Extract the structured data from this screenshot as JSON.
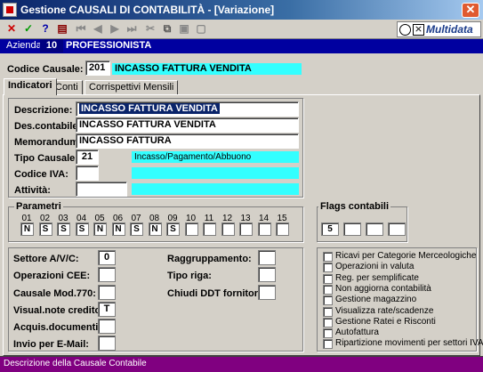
{
  "window": {
    "title": "Gestione CAUSALI DI CONTABILITÀ - [Variazione]",
    "close": "✕"
  },
  "toolbar": {
    "logo_text": "Multidata",
    "logo_x": "⨯"
  },
  "azienda": {
    "label": "Azienda:",
    "code": "10",
    "name": "PROFESSIONISTA"
  },
  "causale": {
    "label": "Codice Causale:",
    "code": "201",
    "description": "INCASSO FATTURA VENDITA"
  },
  "tabs": [
    {
      "label": "Indicatori"
    },
    {
      "label": "Conti"
    },
    {
      "label": "Corrispettivi Mensili"
    }
  ],
  "indicatori": {
    "descrizione": {
      "label": "Descrizione:",
      "value": "INCASSO FATTURA VENDITA"
    },
    "des_contabile": {
      "label": "Des.contabile:",
      "value": "INCASSO FATTURA VENDITA"
    },
    "memorandum": {
      "label": "Memorandum:",
      "value": "INCASSO FATTURA"
    },
    "tipo_causale": {
      "label": "Tipo Causale:",
      "value": "21",
      "description": "Incasso/Pagamento/Abbuono"
    },
    "codice_iva": {
      "label": "Codice IVA:",
      "value": ""
    },
    "attivita": {
      "label": "Attività:",
      "value": ""
    }
  },
  "parametri": {
    "title": "Parametri",
    "numbers": [
      "01",
      "02",
      "03",
      "04",
      "05",
      "06",
      "07",
      "08",
      "09",
      "10",
      "11",
      "12",
      "13",
      "14",
      "15"
    ],
    "values": [
      "N",
      "S",
      "S",
      "S",
      "N",
      "N",
      "S",
      "N",
      "S",
      "",
      "",
      "",
      "",
      "",
      ""
    ]
  },
  "flags": {
    "title": "Flags contabili",
    "values": [
      "5",
      "",
      "",
      ""
    ]
  },
  "settori": {
    "settore_avc": {
      "label": "Settore A/V/C:",
      "value": "0"
    },
    "operazioni_cee": {
      "label": "Operazioni CEE:",
      "value": ""
    },
    "causale_770": {
      "label": "Causale Mod.770:",
      "value": ""
    },
    "visual_note": {
      "label": "Visual.note credito:",
      "value": "T"
    },
    "acquis_documenti": {
      "label": "Acquis.documenti:",
      "value": ""
    },
    "invio_email": {
      "label": "Invio per E-Mail:",
      "value": ""
    },
    "raggruppamento": {
      "label": "Raggruppamento:",
      "value": ""
    },
    "tipo_riga": {
      "label": "Tipo riga:",
      "value": ""
    },
    "chiudi_ddt": {
      "label": "Chiudi DDT fornitori:",
      "value": ""
    }
  },
  "checkboxes": [
    {
      "label": "Ricavi per Categorie Merceologiche",
      "checked": false
    },
    {
      "label": "Operazioni in valuta",
      "checked": false
    },
    {
      "label": "Reg. per semplificate",
      "checked": false
    },
    {
      "label": "Non aggiorna contabilità",
      "checked": false
    },
    {
      "label": "Gestione magazzino",
      "checked": false
    },
    {
      "label": "Visualizza rate/scadenze",
      "checked": false
    },
    {
      "label": "Gestione Ratei e Risconti",
      "checked": false
    },
    {
      "label": "Autofattura",
      "checked": false
    },
    {
      "label": "Ripartizione movimenti per settori IVA",
      "checked": false
    }
  ],
  "status": {
    "text": "Descrizione della Causale Contabile"
  },
  "colors": {
    "title_start": "#0a246a",
    "azienda_bg": "#0000a0",
    "cyan": "#33ffff",
    "status_bg": "#800080"
  }
}
